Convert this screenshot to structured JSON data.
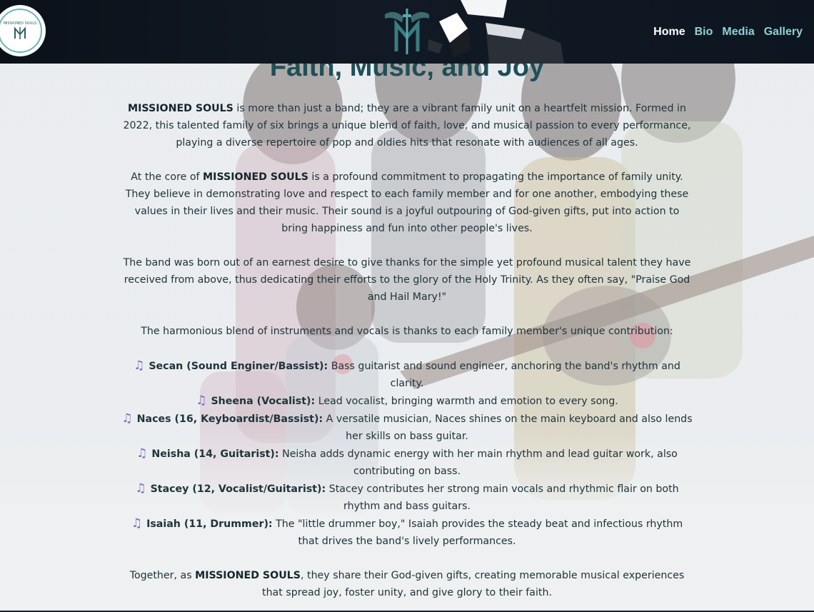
{
  "header": {
    "logo_text": "MISSIONED SOULS",
    "nav": [
      {
        "label": "Home",
        "active": true
      },
      {
        "label": "Bio",
        "active": false
      },
      {
        "label": "Media",
        "active": false
      },
      {
        "label": "Gallery",
        "active": false
      }
    ]
  },
  "main": {
    "title": "Faith, Music, and Joy",
    "band_name": "MISSIONED SOULS",
    "p1_rest": " is more than just a band; they are a vibrant family unit on a heartfelt mission. Formed in 2022, this talented family of six brings a unique blend of faith, love, and musical passion to every performance, playing a diverse repertoire of pop and oldies hits that resonate with audiences of all ages.",
    "p2_start": "At the core of ",
    "p2_rest": " is a profound commitment to propagating the importance of family unity. They believe in demonstrating love and respect to each family member and for one another, embodying these values in their lives and their music. Their sound is a joyful outpouring of God-given gifts, put into action to bring happiness and fun into other people's lives.",
    "p3": "The band was born out of an earnest desire to give thanks for the simple yet profound musical talent they have received from above, thus dedicating their efforts to the glory of the Holy Trinity. As they often say, \"Praise God and Hail Mary!\"",
    "p4": "The harmonious blend of instruments and vocals is thanks to each family member's unique contribution:",
    "members": [
      {
        "name": "Secan (Sound Enginer/Bassist):",
        "desc": " Bass guitarist and sound engineer, anchoring the band's rhythm and clarity."
      },
      {
        "name": "Sheena (Vocalist):",
        "desc": " Lead vocalist, bringing warmth and emotion to every song."
      },
      {
        "name": "Naces (16, Keyboardist/Bassist):",
        "desc": " A versatile musician, Naces shines on the main keyboard and also lends her skills on bass guitar."
      },
      {
        "name": "Neisha (14, Guitarist):",
        "desc": " Neisha adds dynamic energy with her main rhythm and lead guitar work, also contributing on bass."
      },
      {
        "name": "Stacey (12, Vocalist/Guitarist):",
        "desc": " Stacey contributes her strong main vocals and rhythmic flair on both rhythm and bass guitars."
      },
      {
        "name": "Isaiah (11, Drummer):",
        "desc": " The \"little drummer boy,\" Isaiah provides the steady beat and infectious rhythm that drives the band's lively performances."
      }
    ],
    "p5_start": "Together, as ",
    "p5_rest": ", they share their God-given gifts, creating memorable musical experiences that spread joy, foster unity, and give glory to their faith.",
    "note_icon": "music-note-icon"
  },
  "colors": {
    "header_bg": "#0b1119",
    "nav_link": "#8fd0d3",
    "nav_active": "#ffffff",
    "title": "#1f4f57",
    "note_icon": "#7a6cc0"
  }
}
